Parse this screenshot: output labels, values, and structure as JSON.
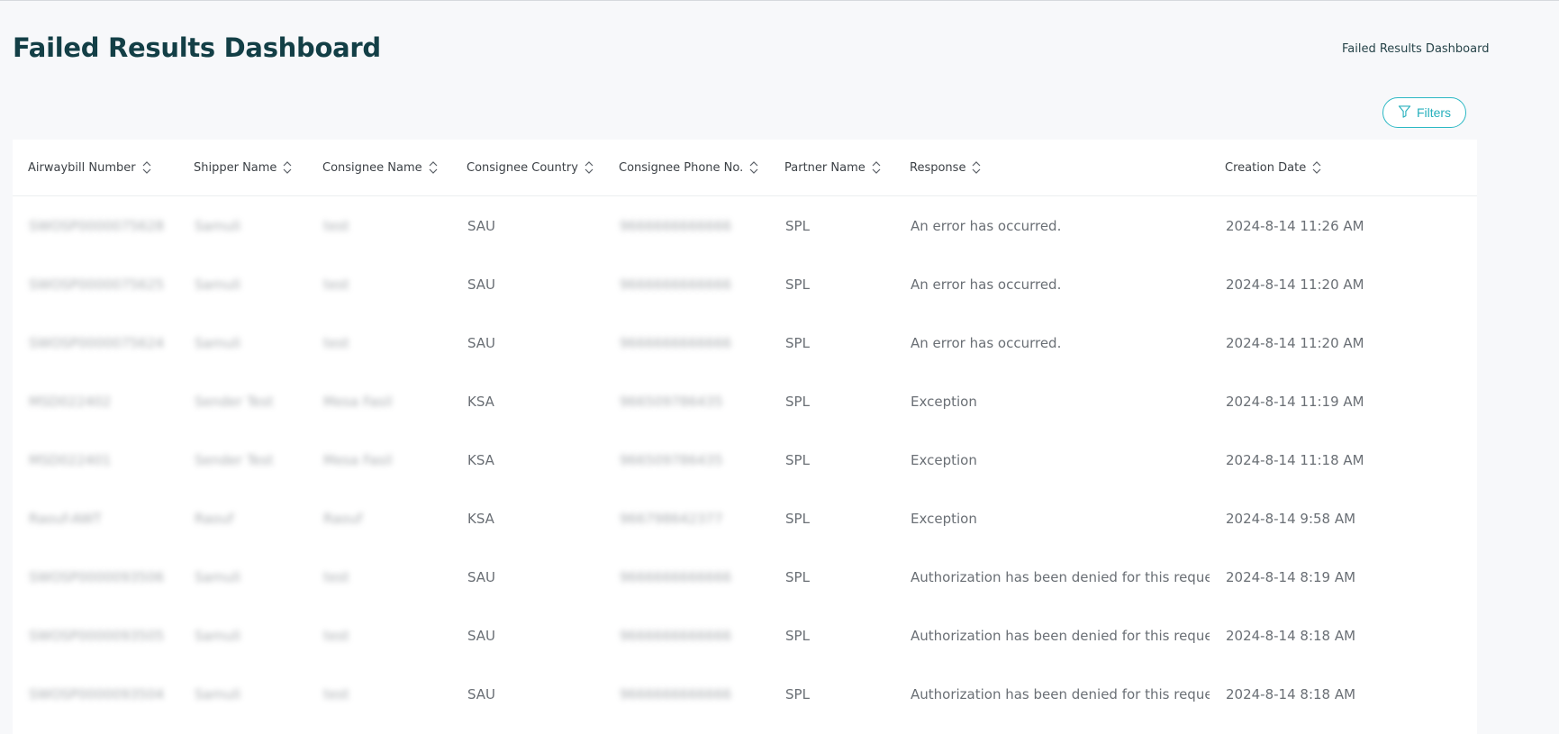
{
  "page": {
    "title": "Failed Results Dashboard",
    "breadcrumb": "Failed Results Dashboard",
    "filters_label": "Filters",
    "accent_color": "#2bb8c4",
    "title_color": "#133f46"
  },
  "table": {
    "columns": [
      {
        "label": "Airwaybill Number"
      },
      {
        "label": "Shipper Name"
      },
      {
        "label": "Consignee Name"
      },
      {
        "label": "Consignee Country"
      },
      {
        "label": "Consignee Phone No."
      },
      {
        "label": "Partner Name"
      },
      {
        "label": "Response"
      },
      {
        "label": "Creation Date"
      }
    ],
    "rows": [
      {
        "awb": "SWOSP0000075628",
        "shipper": "Samuli",
        "consignee": "test",
        "country": "SAU",
        "phone": "9666666666666",
        "partner": "SPL",
        "response": "An error has occurred.",
        "date": "2024-8-14 11:26 AM"
      },
      {
        "awb": "SWOSP0000075625",
        "shipper": "Samuli",
        "consignee": "test",
        "country": "SAU",
        "phone": "9666666666666",
        "partner": "SPL",
        "response": "An error has occurred.",
        "date": "2024-8-14 11:20 AM"
      },
      {
        "awb": "SWOSP0000075624",
        "shipper": "Samuli",
        "consignee": "test",
        "country": "SAU",
        "phone": "9666666666666",
        "partner": "SPL",
        "response": "An error has occurred.",
        "date": "2024-8-14 11:20 AM"
      },
      {
        "awb": "MSD022402",
        "shipper": "Sender Test",
        "consignee": "Mesa Fasil",
        "country": "KSA",
        "phone": "966509786435",
        "partner": "SPL",
        "response": "Exception",
        "date": "2024-8-14 11:19 AM"
      },
      {
        "awb": "MSD022401",
        "shipper": "Sender Test",
        "consignee": "Mesa Fasil",
        "country": "KSA",
        "phone": "966509786435",
        "partner": "SPL",
        "response": "Exception",
        "date": "2024-8-14 11:18 AM"
      },
      {
        "awb": "Raouf-AWT",
        "shipper": "Raouf",
        "consignee": "Raouf",
        "country": "KSA",
        "phone": "966798642377",
        "partner": "SPL",
        "response": "Exception",
        "date": "2024-8-14 9:58 AM"
      },
      {
        "awb": "SWOSP0000093506",
        "shipper": "Samuli",
        "consignee": "test",
        "country": "SAU",
        "phone": "9666666666666",
        "partner": "SPL",
        "response": "Authorization has been denied for this request.",
        "date": "2024-8-14 8:19 AM"
      },
      {
        "awb": "SWOSP0000093505",
        "shipper": "Samuli",
        "consignee": "test",
        "country": "SAU",
        "phone": "9666666666666",
        "partner": "SPL",
        "response": "Authorization has been denied for this request.",
        "date": "2024-8-14 8:18 AM"
      },
      {
        "awb": "SWOSP0000093504",
        "shipper": "Samuli",
        "consignee": "test",
        "country": "SAU",
        "phone": "9666666666666",
        "partner": "SPL",
        "response": "Authorization has been denied for this request.",
        "date": "2024-8-14 8:18 AM"
      }
    ]
  }
}
